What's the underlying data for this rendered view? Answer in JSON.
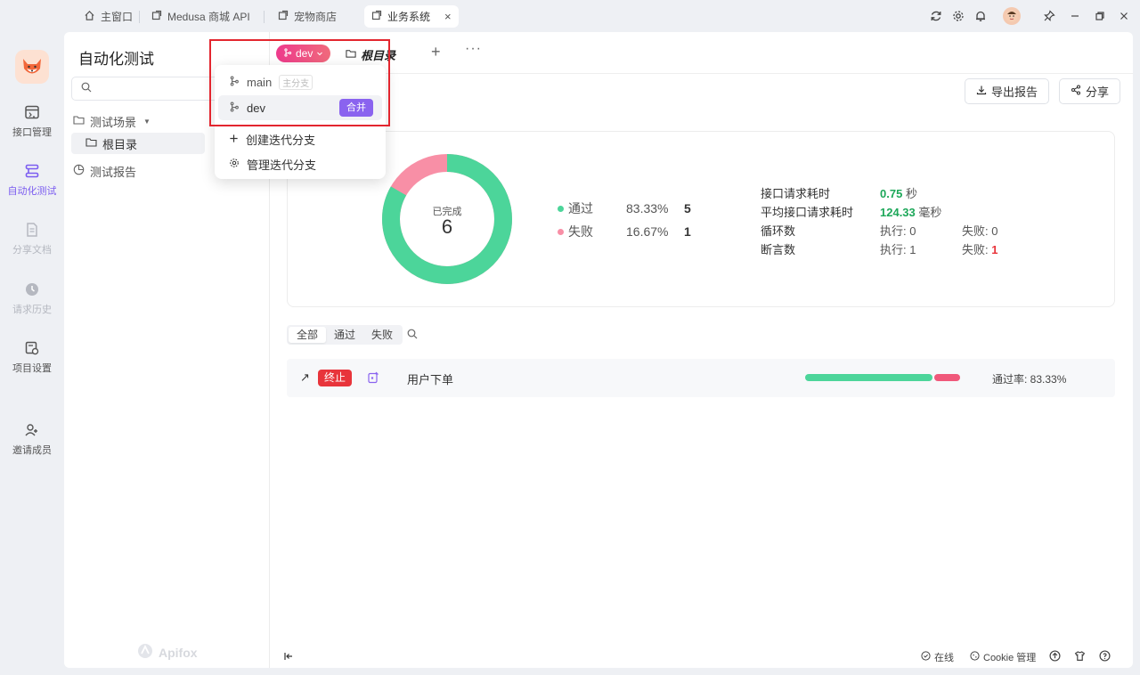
{
  "titlebar": {
    "tabs": [
      {
        "label": "主窗口",
        "icon": "home-icon"
      },
      {
        "label": "Medusa 商城 API",
        "icon": "external-icon"
      },
      {
        "label": "宠物商店",
        "icon": "external-icon"
      },
      {
        "label": "业务系统",
        "icon": "external-icon",
        "active": true
      }
    ],
    "close_glyph": "×"
  },
  "rail": {
    "items": [
      {
        "label": "接口管理"
      },
      {
        "label": "自动化测试",
        "active": true
      },
      {
        "label": "分享文档"
      },
      {
        "label": "请求历史"
      },
      {
        "label": "项目设置"
      },
      {
        "label": "邀请成员"
      }
    ]
  },
  "sidebar": {
    "title": "自动化测试",
    "tree": {
      "scenes_label": "测试场景",
      "root_label": "根目录",
      "report_label": "测试报告"
    },
    "brand": "Apifox"
  },
  "toolbar": {
    "branch_label": "dev",
    "root_tab_label": "根目录",
    "plus": "+",
    "more": "···",
    "export_label": "导出报告",
    "share_label": "分享"
  },
  "branch_menu": {
    "branches": [
      {
        "name": "main",
        "tag": "主分支"
      },
      {
        "name": "dev",
        "action": "合并"
      }
    ],
    "create_label": "创建迭代分支",
    "manage_label": "管理迭代分支"
  },
  "summary": {
    "center_label": "已完成",
    "center_value": "6",
    "legend": [
      {
        "label": "通过",
        "percent": "83.33%",
        "count": "5",
        "color": "#4cd59a"
      },
      {
        "label": "失败",
        "percent": "16.67%",
        "count": "1",
        "color": "#f88fa6"
      }
    ],
    "pass_fraction": 0.8333,
    "stats": {
      "req_time_label": "接口请求耗时",
      "req_time_value": "0.75",
      "req_time_unit": "秒",
      "avg_time_label": "平均接口请求耗时",
      "avg_time_value": "124.33",
      "avg_time_unit": "毫秒",
      "loop_label": "循环数",
      "loop_exec": "执行: 0",
      "loop_fail": "失败: 0",
      "assert_label": "断言数",
      "assert_exec": "执行: 1",
      "assert_fail_label": "失败:",
      "assert_fail_value": "1"
    }
  },
  "filters": {
    "options": [
      "全部",
      "通过",
      "失败"
    ],
    "selected": "全部"
  },
  "results": [
    {
      "arrow": "↗",
      "status": "终止",
      "name": "用户下单",
      "pass_rate_text": "通过率: 83.33%",
      "pass_fraction": 0.8333
    }
  ],
  "statusbar": {
    "online_label": "在线",
    "cookie_label": "Cookie 管理"
  }
}
